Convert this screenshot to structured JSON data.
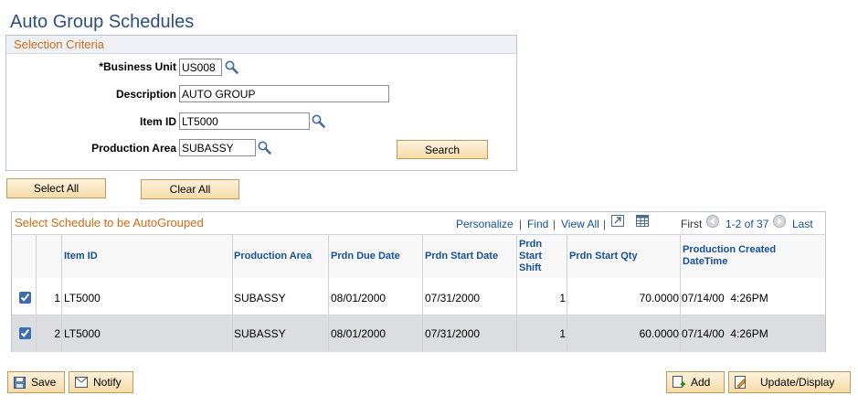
{
  "page": {
    "title": "Auto Group Schedules"
  },
  "criteria": {
    "section_title": "Selection Criteria",
    "business_unit": {
      "label": "*Business Unit",
      "value": "US008"
    },
    "description": {
      "label": "Description",
      "value": "AUTO GROUP"
    },
    "item_id": {
      "label": "Item ID",
      "value": "LT5000"
    },
    "production_area": {
      "label": "Production Area",
      "value": "SUBASSY"
    },
    "search_label": "Search"
  },
  "actions": {
    "select_all": "Select All",
    "clear_all": "Clear All"
  },
  "grid": {
    "title": "Select Schedule to be AutoGrouped",
    "links": {
      "personalize": "Personalize",
      "find": "Find",
      "view_all": "View All"
    },
    "pager": {
      "first": "First",
      "range": "1-2 of 37",
      "last": "Last"
    },
    "columns": {
      "item_id": "Item ID",
      "production_area": "Production Area",
      "due_date": "Prdn Due Date",
      "start_date": "Prdn Start Date",
      "start_shift": "Prdn Start Shift",
      "start_qty": "Prdn Start Qty",
      "created": "Production Created DateTime"
    },
    "rows": [
      {
        "selected": true,
        "num": "1",
        "item_id": "LT5000",
        "production_area": "SUBASSY",
        "due_date": "08/01/2000",
        "start_date": "07/31/2000",
        "shift": "1",
        "qty": "70.0000",
        "created": "07/14/00  4:26PM"
      },
      {
        "selected": true,
        "num": "2",
        "item_id": "LT5000",
        "production_area": "SUBASSY",
        "due_date": "08/01/2000",
        "start_date": "07/31/2000",
        "shift": "1",
        "qty": "60.0000",
        "created": "07/14/00  4:26PM"
      }
    ]
  },
  "toolbar": {
    "save": "Save",
    "notify": "Notify",
    "add": "Add",
    "update_display": "Update/Display"
  },
  "icons": {
    "lookup": "magnifier-icon",
    "first": "arrow-left-circle-icon",
    "last": "arrow-right-circle-icon",
    "download": "spreadsheet-icon",
    "zoom": "view-zoom-icon"
  }
}
